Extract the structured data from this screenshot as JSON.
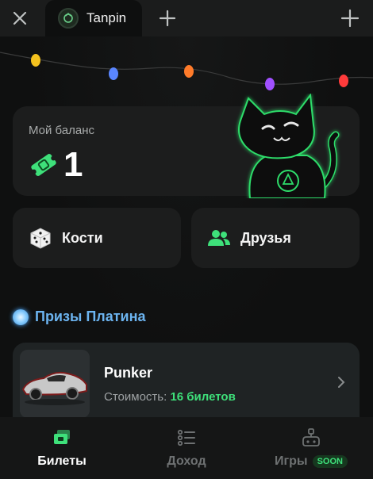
{
  "topbar": {
    "tab_title": "Tanpin",
    "icons": {
      "close": "close-icon",
      "new_tab": "plus-icon",
      "collapse": "collapse-icon"
    }
  },
  "balance": {
    "label": "Мой баланс",
    "value": "1",
    "icon": "ticket-icon",
    "accent_color": "#3ee07a"
  },
  "actions": [
    {
      "label": "Кости",
      "icon": "dice-icon"
    },
    {
      "label": "Друзья",
      "icon": "friends-icon"
    }
  ],
  "prizes_section": {
    "title": "Призы Платина",
    "title_color": "#6cb4f0"
  },
  "prize": {
    "name": "Punker",
    "cost_label": "Стоимость:",
    "cost_value": "16 билетов"
  },
  "bottom_nav": {
    "items": [
      {
        "label": "Билеты",
        "icon": "tickets-icon",
        "active": true
      },
      {
        "label": "Доход",
        "icon": "income-list-icon",
        "active": false
      },
      {
        "label": "Игры",
        "icon": "gamepad-icon",
        "active": false,
        "badge": "SOON"
      }
    ]
  }
}
